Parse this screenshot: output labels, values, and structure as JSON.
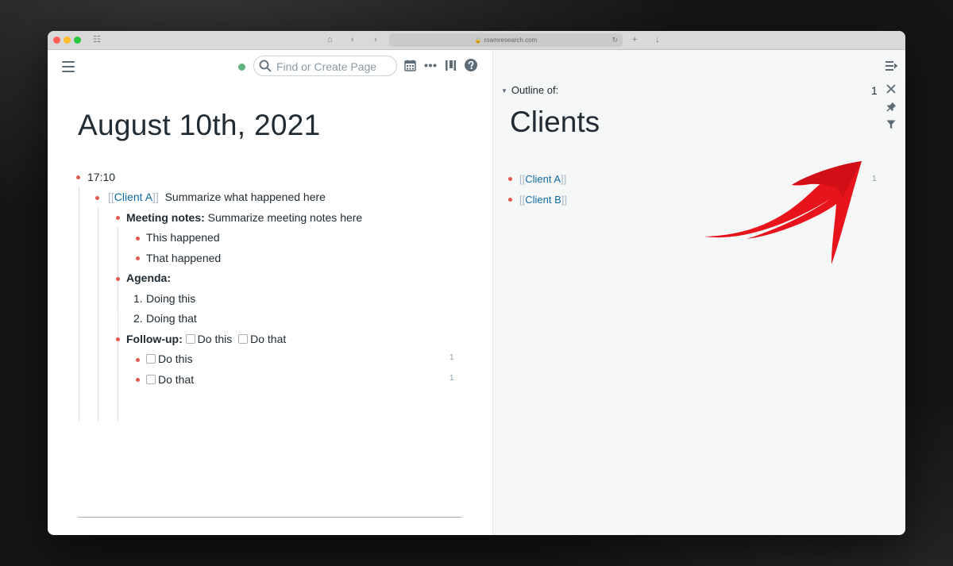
{
  "browser": {
    "url": "roamresearch.com"
  },
  "search": {
    "placeholder": "Find or Create Page"
  },
  "page": {
    "title": "August 10th, 2021",
    "blocks": {
      "time": "17:10",
      "client_ref": "Client A",
      "client_text": "Summarize what happened here",
      "meeting_label": "Meeting notes:",
      "meeting_text": "Summarize meeting notes here",
      "happened1": "This happened",
      "happened2": "That happened",
      "agenda_label": "Agenda:",
      "agenda_items": [
        "Doing this",
        "Doing that"
      ],
      "agenda_nums": [
        "1.",
        "2."
      ],
      "followup_label": "Follow-up:",
      "followup_inline": [
        "Do this",
        "Do that"
      ],
      "todo1": "Do this",
      "todo2": "Do that",
      "todo1_count": "1",
      "todo2_count": "1"
    }
  },
  "sidebar": {
    "outline_label": "Outline of:",
    "count": "1",
    "title": "Clients",
    "items": [
      "Client A",
      "Client B"
    ],
    "item1_count": "1"
  },
  "colors": {
    "bullet": "#e0594f",
    "link": "#106ba3",
    "status_dot": "#5fb57d",
    "annotation_arrow": "#e8141c"
  },
  "icons": [
    "hamburger-icon",
    "search-icon",
    "calendar-icon",
    "more-icon",
    "sidebar-columns-icon",
    "help-icon",
    "toggle-sidebar-icon",
    "close-icon",
    "pin-icon",
    "filter-icon"
  ]
}
